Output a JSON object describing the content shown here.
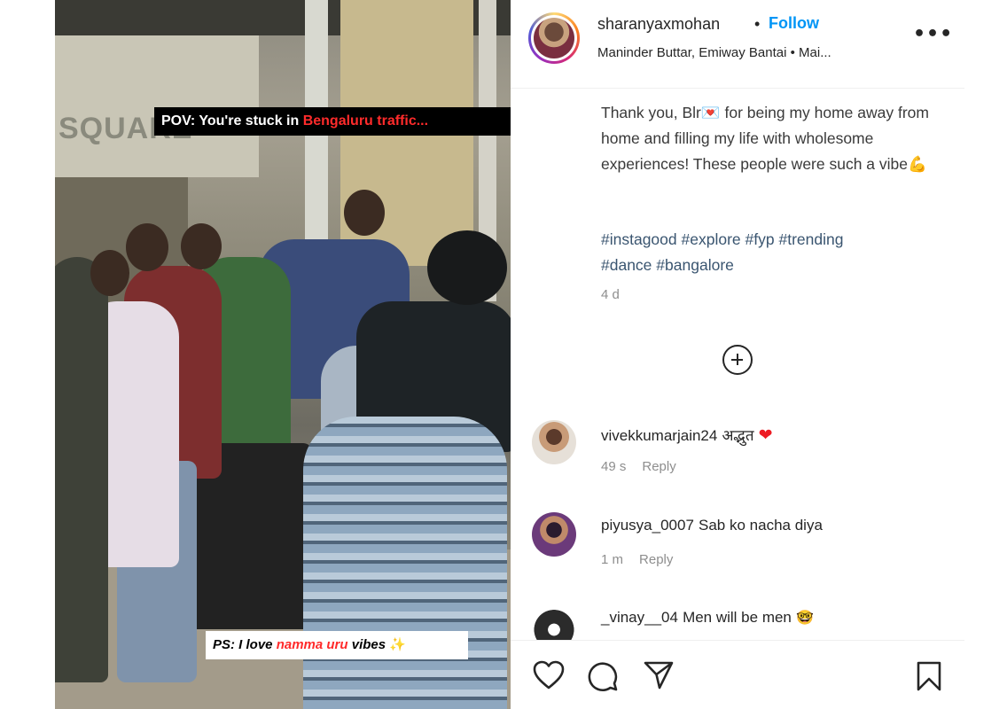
{
  "media": {
    "sign_text": "SQUARE",
    "overlay_top": {
      "prefix": "POV: You're stuck in ",
      "highlight": "Bengaluru traffic..."
    },
    "overlay_bottom": {
      "prefix": "PS: I love ",
      "highlight": "namma uru",
      "suffix": " vibes",
      "sparkle": "✨"
    }
  },
  "header": {
    "username": "sharanyaxmohan",
    "separator": "•",
    "follow_label": "Follow",
    "audio": "Maninder Buttar, Emiway Bantai • Mai...",
    "more": "•••"
  },
  "post": {
    "text_1": "Thank you, Blr",
    "emoji_1": "💌",
    "text_2": " for being my home away from home and filling my life with wholesome experiences! These people were such a vibe",
    "emoji_2": "💪",
    "hashtags": [
      "#instagood",
      "#explore",
      "#fyp",
      "#trending",
      "#dance",
      "#bangalore"
    ],
    "age": "4 d"
  },
  "comments": [
    {
      "user": "vivekkumarjain24",
      "text": "अद्भुत",
      "emoji": "❤",
      "time": "49 s",
      "reply": "Reply"
    },
    {
      "user": "piyusya_0007",
      "text": "Sab ko nacha diya",
      "emoji": "",
      "time": "1 m",
      "reply": "Reply"
    },
    {
      "user": "_vinay__04",
      "text": "Men will be men",
      "emoji": "🤓",
      "time": "",
      "reply": ""
    }
  ],
  "colors": {
    "accent": "#0095f6",
    "text": "#262626",
    "muted": "#8e8e8e",
    "caption_highlight": "#ff2b2b"
  },
  "icons": [
    "heart-icon",
    "comment-icon",
    "share-icon",
    "bookmark-icon",
    "add-comment-icon",
    "more-options-icon"
  ]
}
